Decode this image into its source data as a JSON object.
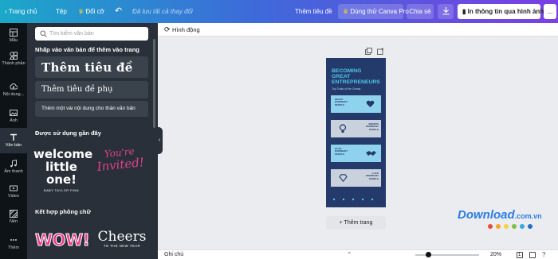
{
  "topbar": {
    "home": "Trang chủ",
    "file": "Tệp",
    "resize": "Đổi cỡ",
    "saved_status": "Đã lưu tất cả thay đổi",
    "add_title": "Thêm tiêu đề",
    "try_pro": "Dùng thử Canva Pro",
    "share": "Chia sẻ",
    "print": "In thông tin qua hình ảnh",
    "more": "..."
  },
  "rail": [
    {
      "label": "Mẫu",
      "icon": "template-icon"
    },
    {
      "label": "Thành phần",
      "icon": "elements-icon"
    },
    {
      "label": "Nội dung...",
      "icon": "upload-icon"
    },
    {
      "label": "Ảnh",
      "icon": "photo-icon"
    },
    {
      "label": "Văn bản",
      "icon": "text-icon"
    },
    {
      "label": "Âm thanh",
      "icon": "music-icon"
    },
    {
      "label": "Video",
      "icon": "video-icon"
    },
    {
      "label": "Nền",
      "icon": "background-icon"
    },
    {
      "label": "Thêm",
      "icon": "more-icon"
    }
  ],
  "panel": {
    "search_placeholder": "Tìm kiếm văn bản",
    "click_to_add": "Nhấp vào văn bản để thêm vào trang",
    "add_heading": "Thêm tiêu đề",
    "add_subheading": "Thêm tiêu đề phụ",
    "add_body": "Thêm một vài nội dung cho thân văn bản",
    "recent": "Được sử dụng gần đây",
    "combos": "Kết hợp phông chữ",
    "tpl_welcome_1": "welcome",
    "tpl_welcome_2": "little one!",
    "tpl_welcome_3": "BABY TAYLOR FINN",
    "tpl_invited_1": "You're",
    "tpl_invited_2": "Invited!",
    "tpl_wow": "WOW!",
    "tpl_cheers_1": "Cheers",
    "tpl_cheers_2": "TO THE NEW YEAR"
  },
  "canvas": {
    "animation": "Hình động",
    "design_title": "BECOMING GREAT ENTREPRENEURS",
    "design_subtitle": "Top Traits of the Greats",
    "strips": [
      "HEART DOMINANT PEOPLE",
      "SMARTS DOMINANT PEOPLE",
      "GUTS DOMINANT PEOPLE",
      "LUCK DOMINANT PEOPLE"
    ],
    "add_page": "+ Thêm trang"
  },
  "bottombar": {
    "notes": "Ghi chú",
    "zoom": "20%",
    "zoom_fraction": 0.2,
    "page_count": "1"
  },
  "watermark": {
    "text": "Download",
    "suffix": ".com.vn",
    "dots": [
      "#e94b3c",
      "#f6a623",
      "#f8d23a",
      "#7ac142",
      "#37a7e0",
      "#1f6fc5"
    ]
  },
  "colors": {
    "topbar_start": "#1ba8c9",
    "topbar_end": "#7b3fe4",
    "rail_bg": "#0e1318",
    "panel_bg": "#293039",
    "design_navy": "#233a6b",
    "design_light": "#8fd2ee"
  }
}
